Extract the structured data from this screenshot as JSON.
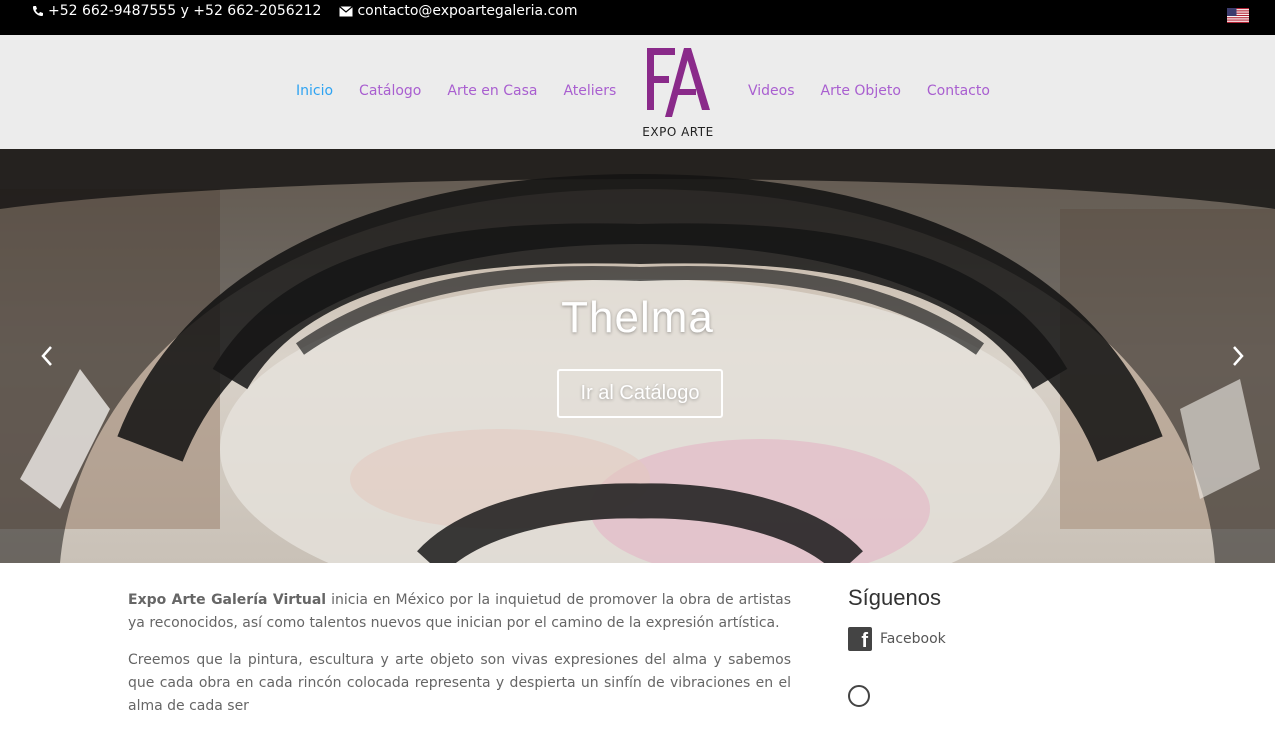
{
  "topbar": {
    "phone": "+52 662-9487555 y +52 662-2056212",
    "email": "contacto@expoartegaleria.com",
    "language_flag": "us-flag-icon"
  },
  "nav": {
    "left": [
      "Inicio",
      "Catálogo",
      "Arte en Casa",
      "Ateliers"
    ],
    "right": [
      "Videos",
      "Arte Objeto",
      "Contacto"
    ],
    "active": "Inicio"
  },
  "logo": {
    "text": "EXPO ARTE",
    "color": "#8a2a8a"
  },
  "hero": {
    "title": "Thelma",
    "button": "Ir al Catálogo"
  },
  "content": {
    "p1_bold": "Expo Arte Galería Virtual",
    "p1_rest": " inicia en México por la inquietud de promover la obra de artistas ya reconocidos, así como talentos nuevos que inician por el camino de la expresión artística.",
    "p2": "Creemos que la pintura, escultura y arte objeto son vivas expresiones del alma y sabemos que cada obra en cada rincón colocada representa y despierta un sinfín de vibraciones en el alma de cada ser"
  },
  "sidebar": {
    "title": "Síguenos",
    "links": [
      "Facebook"
    ]
  },
  "colors": {
    "nav": "#a95fd0",
    "nav_active": "#2ea3f2",
    "topbar": "#000000",
    "header": "#ececec"
  }
}
